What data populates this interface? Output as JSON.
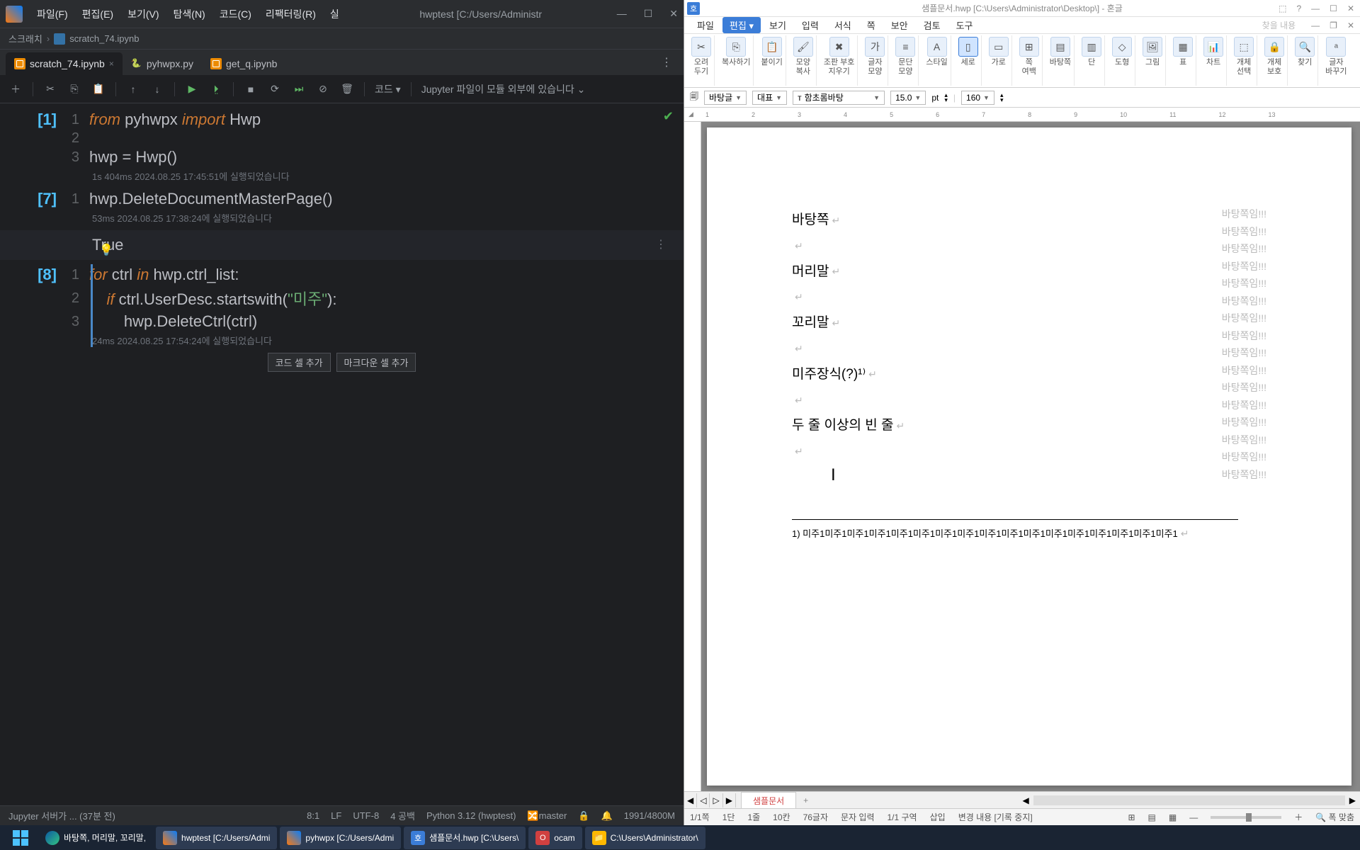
{
  "ide": {
    "menus": [
      "파일(F)",
      "편집(E)",
      "보기(V)",
      "탐색(N)",
      "코드(C)",
      "리팩터링(R)",
      "실"
    ],
    "title_center": "hwptest [C:/Users/Administr",
    "breadcrumb": {
      "item1": "스크래치",
      "item2": "scratch_74.ipynb"
    },
    "tabs": [
      {
        "label": "scratch_74.ipynb",
        "icon": "ipynb",
        "active": true,
        "close": true
      },
      {
        "label": "pyhwpx.py",
        "icon": "py",
        "active": false,
        "close": false
      },
      {
        "label": "get_q.ipynb",
        "icon": "ipynb",
        "active": false,
        "close": false
      }
    ],
    "toolbar": {
      "code_label": "코드",
      "jupyter_msg": "Jupyter 파일이 모듈 외부에 있습니다"
    },
    "cells": {
      "c1": {
        "prompt": "[1]",
        "lines": {
          "1": "1",
          "2": "2",
          "3": "3"
        },
        "exec": "1s 404ms 2024.08.25 17:45:51에 실행되었습니다"
      },
      "c2": {
        "prompt": "[7]",
        "lines": {
          "1": "1"
        },
        "exec": "53ms 2024.08.25 17:38:24에 실행되었습니다"
      },
      "out2": {
        "text": "True"
      },
      "c3": {
        "prompt": "[8]",
        "lines": {
          "1": "1",
          "2": "2",
          "3": "3"
        },
        "exec": "24ms 2024.08.25 17:54:24에 실행되었습니다"
      }
    },
    "code": {
      "c1l1_from": "from",
      "c1l1_mod": " pyhwpx ",
      "c1l1_imp": "import",
      "c1l1_cls": " Hwp",
      "c1l3": "hwp = Hwp()",
      "c2l1": "hwp.DeleteDocumentMasterPage()",
      "c3l1_for": "for",
      "c3l1_mid": " ctrl ",
      "c3l1_in": "in",
      "c3l1_rest": " hwp.ctrl_list:",
      "c3l2_if": "    if",
      "c3l2_rest": " ctrl.UserDesc.startswith(",
      "c3l2_str": "\"미주\"",
      "c3l2_end": "):",
      "c3l3": "        hwp.DeleteCtrl(ctrl)"
    },
    "add_buttons": {
      "code": "코드 셀 추가",
      "md": "마크다운 셀 추가"
    },
    "status": {
      "left": "Jupyter 서버가 ... (37분 전)",
      "pos": "8:1",
      "enc": "LF",
      "charset": "UTF-8",
      "indent": "4 공백",
      "py": "Python 3.12 (hwptest)",
      "branch": "master",
      "mem": "1991/4800M"
    }
  },
  "hwp": {
    "title": "샘플문서.hwp [C:\\Users\\Administrator\\Desktop\\] - 혼글",
    "sidebar_label": "찾을 내용",
    "menus": [
      "파일",
      "편집",
      "보기",
      "입력",
      "서식",
      "쪽",
      "보안",
      "검토",
      "도구"
    ],
    "ribbon": [
      {
        "label": "오려\n두기",
        "icon": "✂"
      },
      {
        "label": "복사하기",
        "icon": "⎘"
      },
      {
        "label": "붙이기",
        "icon": "📋"
      },
      {
        "label": "모양\n복사",
        "icon": "🖌"
      },
      {
        "label": "조판 부호\n지우기",
        "icon": "✖"
      },
      {
        "label": "글자\n모양",
        "icon": "가"
      },
      {
        "label": "문단\n모양",
        "icon": "≡"
      },
      {
        "label": "스타일",
        "icon": "A"
      },
      {
        "label": "세로",
        "icon": "▯",
        "active": true
      },
      {
        "label": "가로",
        "icon": "▭"
      },
      {
        "label": "쪽\n여백",
        "icon": "⊞"
      },
      {
        "label": "바탕쪽",
        "icon": "▤"
      },
      {
        "label": "단",
        "icon": "▥"
      },
      {
        "label": "도형",
        "icon": "◇"
      },
      {
        "label": "그림",
        "icon": "🖼"
      },
      {
        "label": "표",
        "icon": "▦"
      },
      {
        "label": "차트",
        "icon": "📊"
      },
      {
        "label": "개체\n선택",
        "icon": "⬚"
      },
      {
        "label": "개체\n보호",
        "icon": "🔒"
      },
      {
        "label": "찾기",
        "icon": "🔍"
      },
      {
        "label": "글자\n바꾸기",
        "icon": "ᵃ"
      }
    ],
    "toolbar2": {
      "style": "바탕글",
      "lang": "대표",
      "font": "함초롬바탕",
      "size": "15.0",
      "unit": "pt",
      "zoom": "160"
    },
    "document": {
      "lines": [
        "바탕쪽",
        "",
        "머리말",
        "",
        "꼬리말",
        "",
        "미주장식(?)¹⁾",
        "",
        "두 줄 이상의 빈 줄",
        ""
      ],
      "side_repeat": "바탕쪽임!!!",
      "side_count": 16,
      "footnote": "1) 미주1미주1미주1미주1미주1미주1미주1미주1미주1미주1미주1미주1미주1미주1미주1미주1미주1"
    },
    "doc_tab": "샘플문서",
    "status": {
      "page": "1/1쪽",
      "dan": "1단",
      "line": "1줄",
      "col": "10칸",
      "chars": "76글자",
      "input": "문자 입력",
      "section": "1/1 구역",
      "insert": "삽입",
      "track": "변경 내용 [기록 중지]",
      "fit": "폭 맞춤"
    }
  },
  "taskbar": {
    "items": [
      {
        "label": "바탕쪽, 머리말, 꼬리말,",
        "icon": "edge"
      },
      {
        "label": "hwptest [C:/Users/Admi",
        "icon": "pycharm"
      },
      {
        "label": "pyhwpx [C:/Users/Admi",
        "icon": "pycharm"
      },
      {
        "label": "샘플문서.hwp [C:\\Users\\",
        "icon": "hwp"
      },
      {
        "label": "ocam",
        "icon": "ocam"
      },
      {
        "label": "C:\\Users\\Administrator\\",
        "icon": "folder"
      }
    ]
  }
}
